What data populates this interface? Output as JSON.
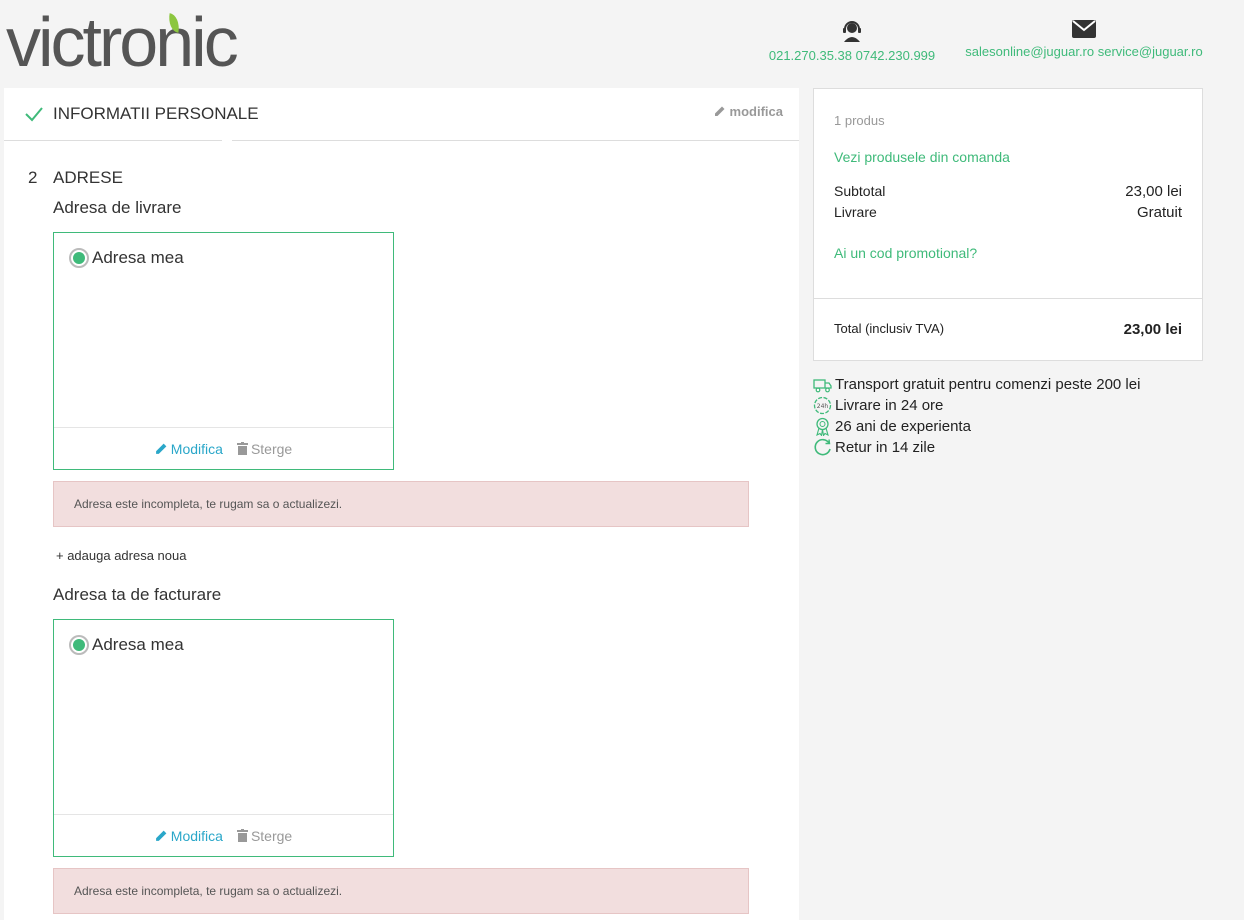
{
  "header": {
    "logo_text": "victronic",
    "phone": "021.270.35.38 0742.230.999",
    "email": "salesonline@juguar.ro service@juguar.ro"
  },
  "personal": {
    "title": "INFORMATII PERSONALE",
    "edit_label": "modifica"
  },
  "addresses": {
    "step_number": "2",
    "title": "ADRESE",
    "delivery_title": "Adresa de livrare",
    "billing_title": "Adresa ta de facturare",
    "delivery_card": {
      "name": "Adresa mea",
      "edit_label": "Modifica",
      "delete_label": "Sterge"
    },
    "billing_card": {
      "name": "Adresa mea",
      "edit_label": "Modifica",
      "delete_label": "Sterge"
    },
    "alert_text": "Adresa este incompleta, te rugam sa o actualizezi.",
    "add_new_label": "+ adauga adresa noua"
  },
  "summary": {
    "count": "1 produs",
    "view_products": "Vezi produsele din comanda",
    "subtotal_label": "Subtotal",
    "subtotal_value": "23,00 lei",
    "delivery_label": "Livrare",
    "delivery_value": "Gratuit",
    "promo_label": "Ai un cod promotional?",
    "total_label": "Total (inclusiv TVA)",
    "total_value": "23,00 lei"
  },
  "perks": [
    {
      "icon": "truck-icon",
      "text": "Transport gratuit pentru comenzi peste 200 lei"
    },
    {
      "icon": "clock-24-icon",
      "text": "Livrare in 24 ore"
    },
    {
      "icon": "award-icon",
      "text": "26 ani de experienta"
    },
    {
      "icon": "return-icon",
      "text": "Retur in 14 zile"
    }
  ],
  "colors": {
    "accent": "#3fba7a",
    "link_blue": "#2aa7c9",
    "alert_bg": "#f2dede"
  }
}
